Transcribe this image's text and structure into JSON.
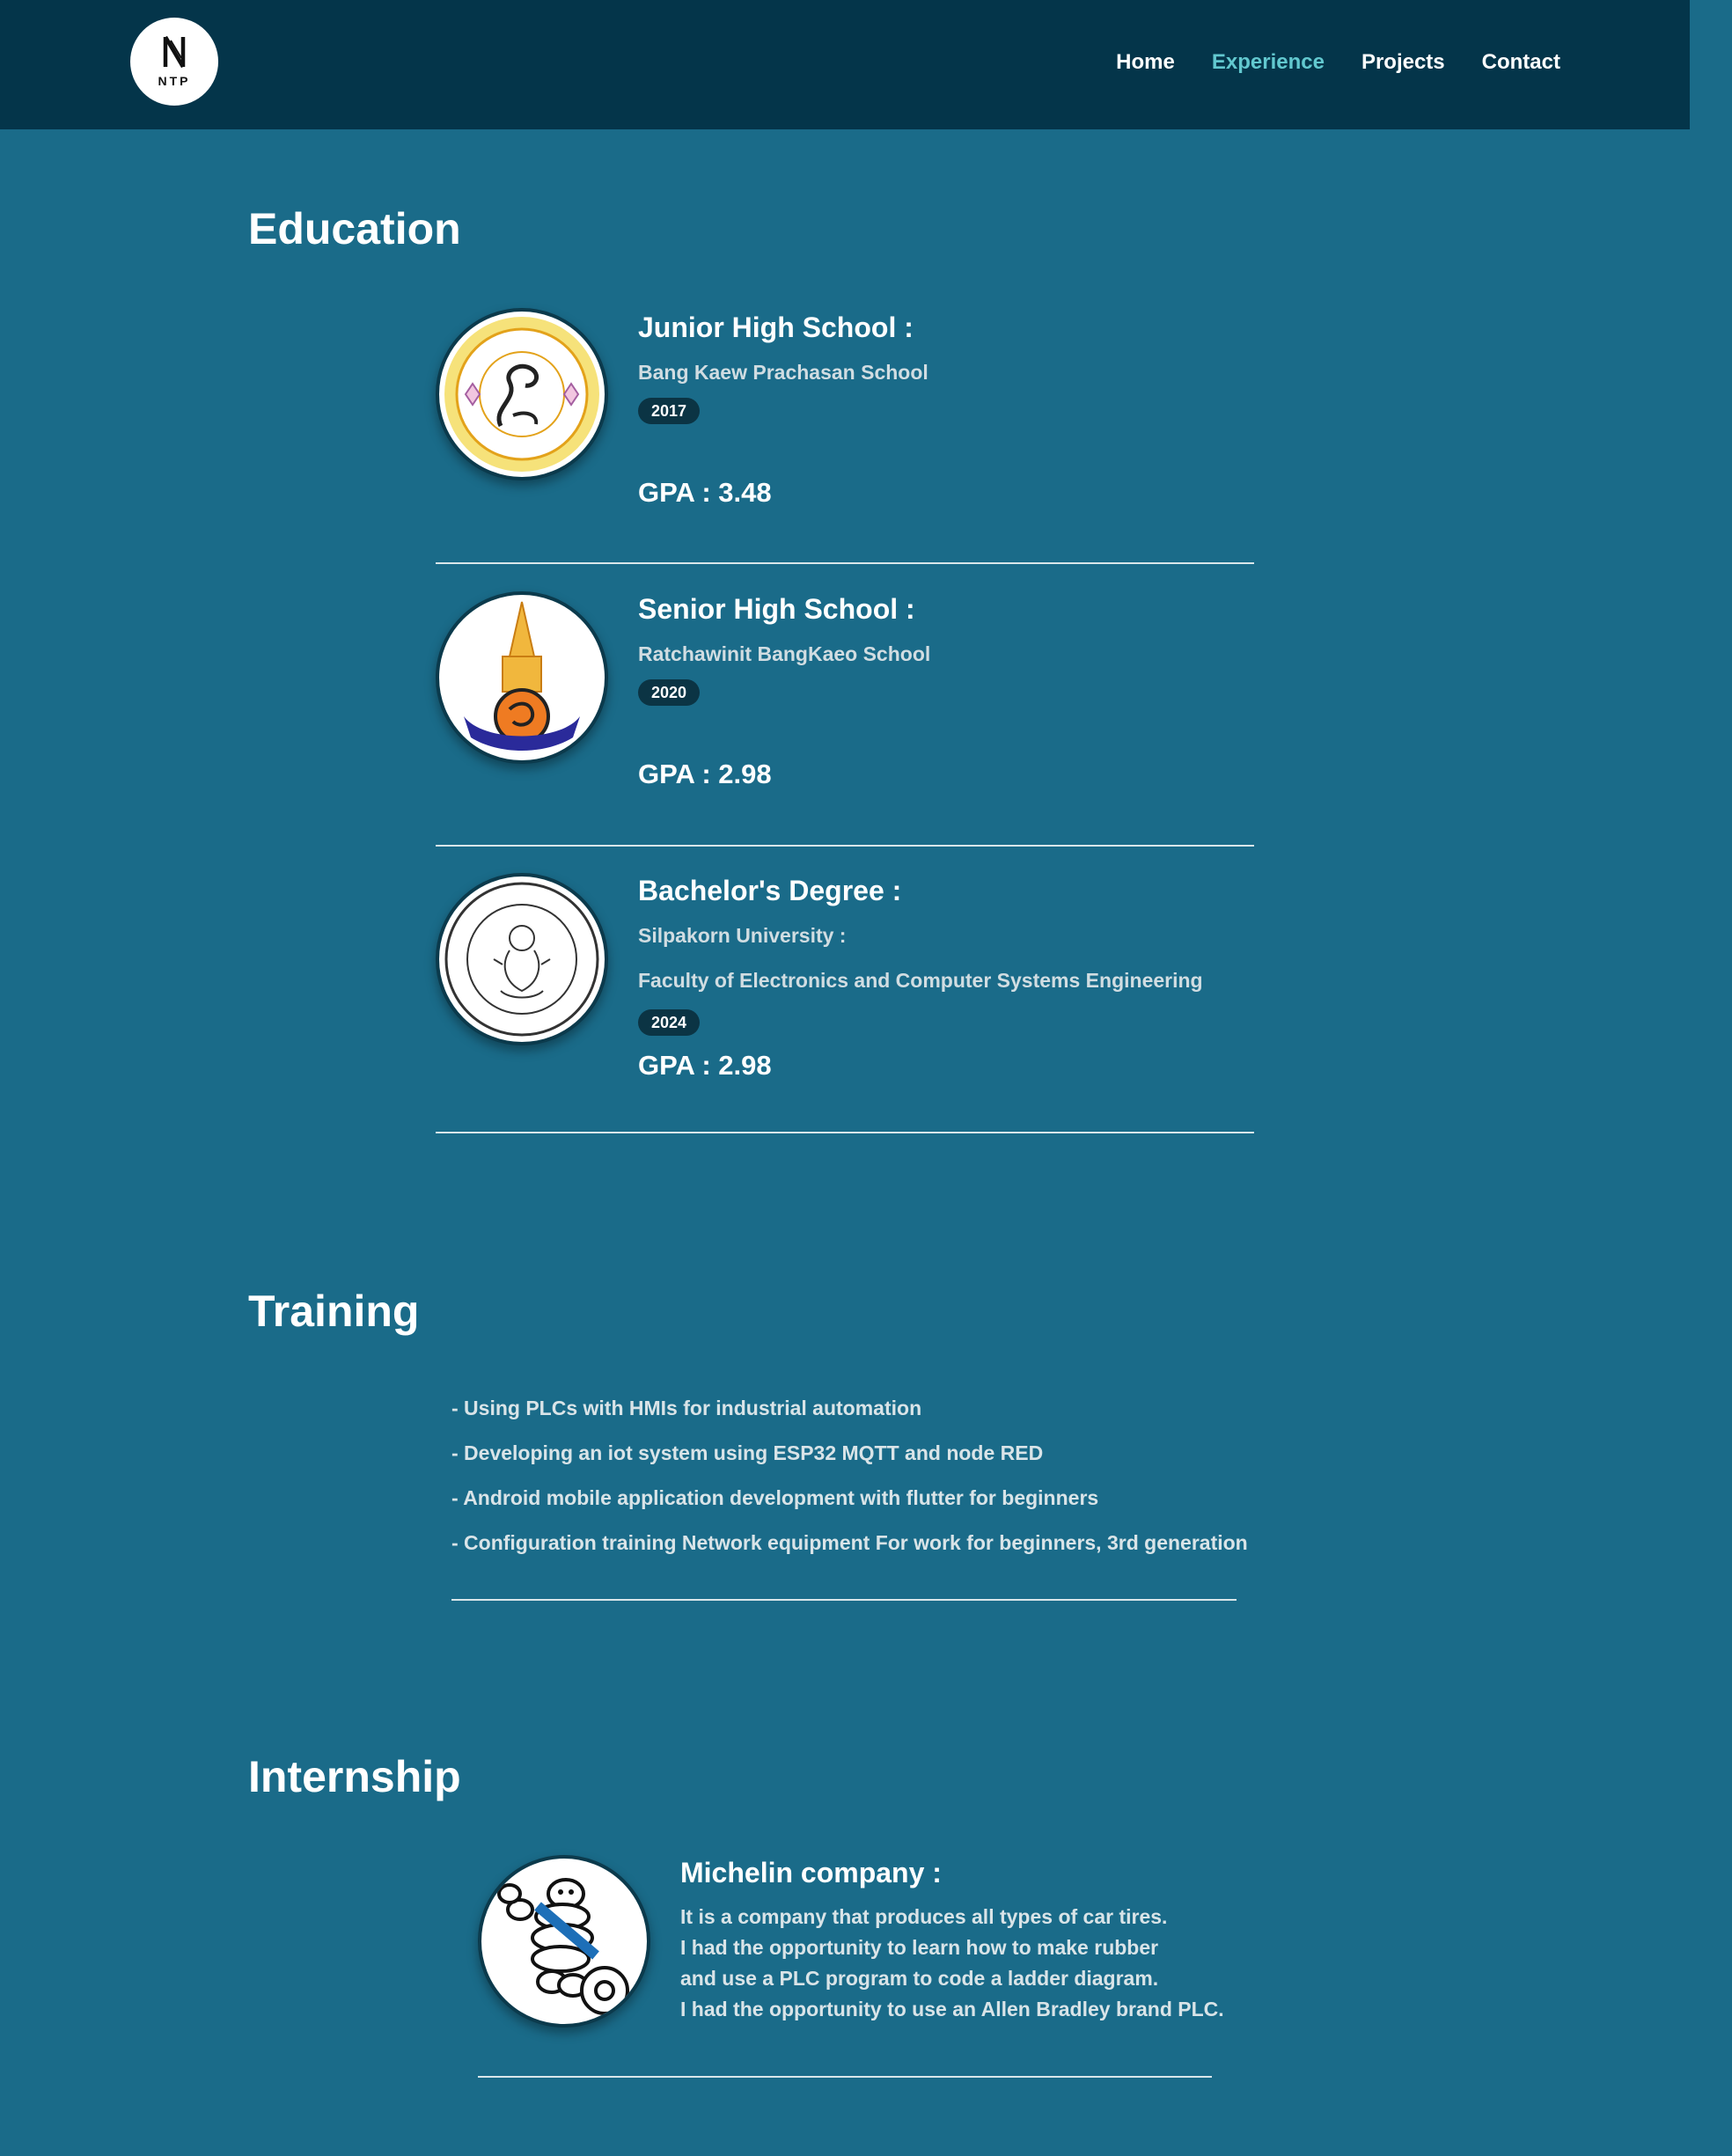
{
  "nav": {
    "logo_text": "NTP",
    "links": [
      {
        "label": "Home"
      },
      {
        "label": "Experience",
        "active": true
      },
      {
        "label": "Projects"
      },
      {
        "label": "Contact"
      }
    ]
  },
  "education": {
    "title": "Education",
    "items": [
      {
        "heading": "Junior High School :",
        "school": "Bang Kaew Prachasan School",
        "year": "2017",
        "gpa": "GPA : 3.48",
        "emblem_icon": "bang-kaew-prachasan-emblem-icon"
      },
      {
        "heading": "Senior High School :",
        "school": "Ratchawinit BangKaeo School",
        "year": "2020",
        "gpa": "GPA : 2.98",
        "emblem_icon": "ratchawinit-emblem-icon"
      },
      {
        "heading": "Bachelor's Degree :",
        "school": "Silpakorn University :",
        "faculty": "Faculty of Electronics and Computer Systems Engineering",
        "year": "2024",
        "gpa": "GPA : 2.98",
        "emblem_icon": "silpakorn-university-seal-icon"
      }
    ]
  },
  "training": {
    "title": "Training",
    "items": [
      "- Using PLCs with HMIs for industrial automation",
      "- Developing an iot system using ESP32 MQTT and node RED",
      "- Android mobile application development with flutter for beginners",
      "- Configuration training Network equipment For work for beginners, 3rd generation"
    ]
  },
  "internship": {
    "title": "Internship",
    "company": "Michelin company :",
    "description": [
      "It is a company that produces all types of car tires.",
      "I had the opportunity to learn how to make rubber",
      "and use a PLC program to code a ladder diagram.",
      "I had the opportunity to use an Allen Bradley brand PLC."
    ],
    "logo_icon": "michelin-man-icon"
  },
  "colors": {
    "page_background": "#1a6b89",
    "navbar_background": "#04354a",
    "active_link": "#62c8cf",
    "badge_background": "#0b3444"
  }
}
